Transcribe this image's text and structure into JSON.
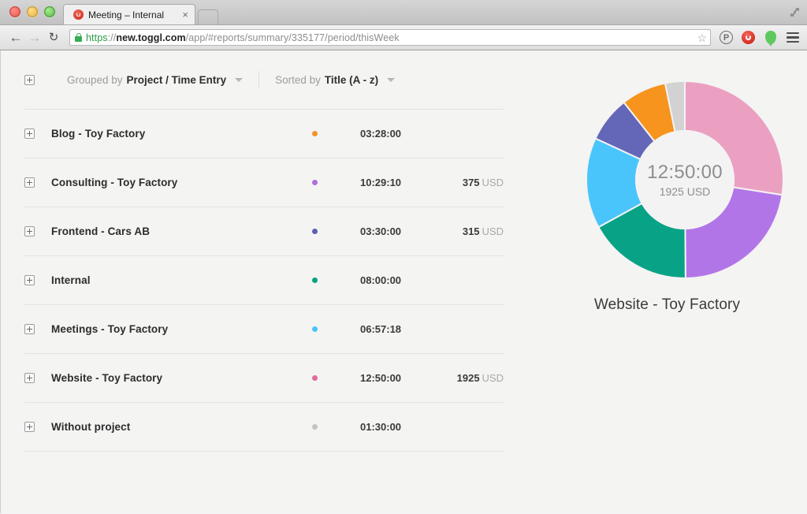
{
  "window": {
    "traffic_lights": [
      "close",
      "minimize",
      "maximize"
    ],
    "fullscreen_icon": "fullscreen-arrows-icon"
  },
  "tab": {
    "title": "Meeting – Internal",
    "favicon": "toggl-favicon",
    "close_label": "×",
    "new_tab_label": ""
  },
  "toolbar": {
    "back_label": "←",
    "forward_label": "→",
    "reload_label": "↻",
    "url": {
      "scheme": "https",
      "separator": "://",
      "host": "new.toggl.com",
      "path": "/app/#reports/summary/335177/period/thisWeek",
      "full": "https://new.toggl.com/app/#reports/summary/335177/period/thisWeek"
    },
    "star_label": "☆",
    "extensions": [
      {
        "name": "pocket-extension-icon",
        "label": "P"
      },
      {
        "name": "toggl-extension-icon",
        "label": ""
      },
      {
        "name": "location-pin-icon",
        "label": ""
      }
    ],
    "menu_label": "menu-icon"
  },
  "filters": {
    "expand_all_icon": "expand-all-icon",
    "grouped_by": {
      "label": "Grouped by",
      "value": "Project / Time Entry"
    },
    "sorted_by": {
      "label": "Sorted by",
      "value": "Title (A - z)"
    }
  },
  "report": {
    "rows": [
      {
        "title": "Blog - Toy Factory",
        "color": "#f3932a",
        "duration": "03:28:00",
        "amount": "",
        "currency": ""
      },
      {
        "title": "Consulting - Toy Factory",
        "color": "#b06ede",
        "duration": "10:29:10",
        "amount": "375",
        "currency": "USD"
      },
      {
        "title": "Frontend - Cars AB",
        "color": "#5d5fb4",
        "duration": "03:30:00",
        "amount": "315",
        "currency": "USD"
      },
      {
        "title": "Internal",
        "color": "#07a283",
        "duration": "08:00:00",
        "amount": "",
        "currency": ""
      },
      {
        "title": "Meetings - Toy Factory",
        "color": "#49c4fa",
        "duration": "06:57:18",
        "amount": "",
        "currency": ""
      },
      {
        "title": "Website - Toy Factory",
        "color": "#e06b9e",
        "duration": "12:50:00",
        "amount": "1925",
        "currency": "USD"
      },
      {
        "title": "Without project",
        "color": "#c4c4c4",
        "duration": "01:30:00",
        "amount": "",
        "currency": ""
      }
    ]
  },
  "chart_data": {
    "type": "pie",
    "title": "Website - Toy Factory",
    "center_value": "12:50:00",
    "center_sub": "1925 USD",
    "legend_position": "none",
    "grid": false,
    "hole_ratio": 0.5,
    "unit": "hours",
    "categories": [
      "Website - Toy Factory",
      "Consulting - Toy Factory",
      "Internal",
      "Meetings - Toy Factory",
      "Frontend - Cars AB",
      "Blog - Toy Factory",
      "Without project"
    ],
    "values": [
      12.8333,
      10.4861,
      8.0,
      6.955,
      3.5,
      3.4667,
      1.5
    ],
    "durations": [
      "12:50:00",
      "10:29:10",
      "08:00:00",
      "06:57:18",
      "03:30:00",
      "03:28:00",
      "01:30:00"
    ],
    "colors": [
      "#eba0c2",
      "#b275e8",
      "#08a387",
      "#49c5fb",
      "#6467b7",
      "#f7941e",
      "#d2d2d2"
    ],
    "slice_degrees": [
      99.5,
      81.3,
      62.0,
      53.9,
      27.1,
      26.9,
      11.6
    ],
    "start_angle_deg": 0
  }
}
